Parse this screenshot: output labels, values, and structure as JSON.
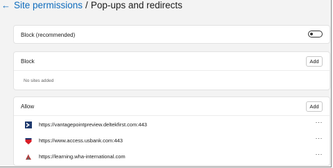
{
  "header": {
    "back_glyph": "←",
    "parent_link": "Site permissions",
    "separator": "/",
    "current": "Pop-ups and redirects"
  },
  "block_recommended": {
    "label": "Block (recommended)",
    "toggle_on": false
  },
  "block_section": {
    "title": "Block",
    "add_label": "Add",
    "empty_text": "No sites added"
  },
  "allow_section": {
    "title": "Allow",
    "add_label": "Add",
    "sites": [
      {
        "url": "https://vantagepointpreview.deltekfirst.com:443",
        "icon": "deltek-favicon-icon",
        "color": "#1f3a6e"
      },
      {
        "url": "https://www.access.usbank.com:443",
        "icon": "usbank-shield-icon",
        "color": "#d71e28"
      },
      {
        "url": "https://learning.wha-international.com",
        "icon": "wha-favicon-icon",
        "color": "#b23a3a"
      }
    ],
    "more_glyph": "···"
  },
  "colors": {
    "accent": "#0f6cbd",
    "background": "#f3f3f3",
    "card": "#ffffff"
  }
}
